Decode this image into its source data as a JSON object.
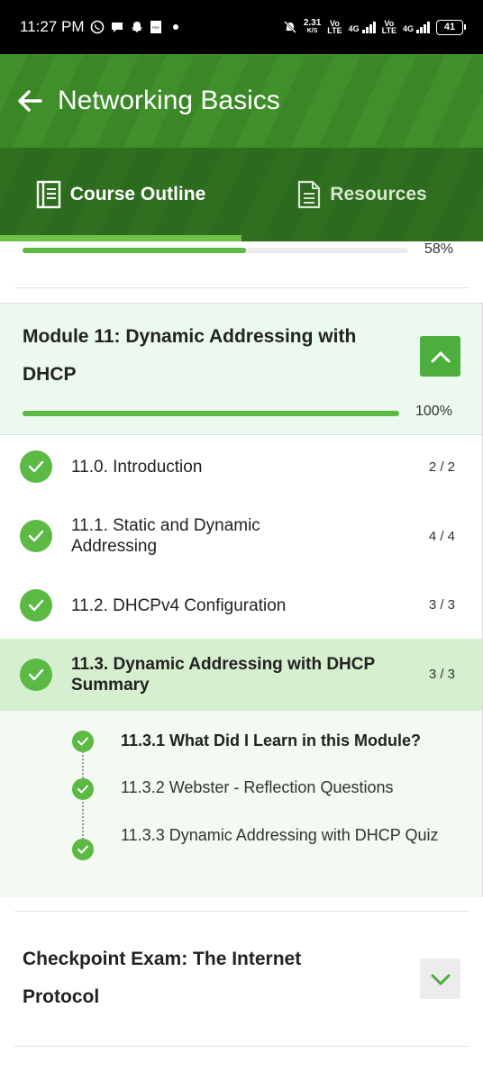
{
  "status_bar": {
    "time": "11:27 PM",
    "speed_value": "2.31",
    "speed_unit": "K/S",
    "sim1_tag_a": "Vo",
    "sim1_tag_b": "LTE",
    "sim1_net": "4G",
    "sim2_tag_a": "Vo",
    "sim2_tag_b": "LTE",
    "sim2_net": "4G",
    "battery": "41",
    "icons": [
      "whatsapp-icon",
      "chat-icon",
      "snapchat-icon",
      "pdf-icon",
      "dot-icon",
      "mute-bell-icon",
      "signal-icon",
      "battery-icon"
    ]
  },
  "header": {
    "title": "Networking Basics",
    "back_icon": "arrow-left-icon"
  },
  "tabs": [
    {
      "label": "Course Outline",
      "icon": "book-icon",
      "active": true
    },
    {
      "label": "Resources",
      "icon": "document-icon",
      "active": false
    }
  ],
  "overall_progress": {
    "percent_label": "58%",
    "value": 0.58
  },
  "module": {
    "title": "Module 11: Dynamic Addressing with DHCP",
    "percent_label": "100%",
    "value": 1.0,
    "collapse_icon": "chevron-up-icon",
    "lessons": [
      {
        "title": "11.0. Introduction",
        "count": "2 / 2"
      },
      {
        "title": "11.1. Static and Dynamic Addressing",
        "count": "4 / 4"
      },
      {
        "title": "11.2. DHCPv4 Configuration",
        "count": "3 / 3"
      },
      {
        "title": "11.3. Dynamic Addressing with DHCP Summary",
        "count": "3 / 3"
      }
    ],
    "sub_items": [
      {
        "title": "11.3.1 What Did I Learn in this Module?"
      },
      {
        "title": "11.3.2 Webster - Reflection Questions"
      },
      {
        "title": "11.3.3 Dynamic Addressing with DHCP Quiz"
      }
    ]
  },
  "next_module": {
    "title": "Checkpoint Exam: The Internet Protocol",
    "expand_icon": "chevron-down-icon"
  },
  "colors": {
    "header_green": "#3f8f2a",
    "tab_green": "#2f6f1f",
    "accent": "#5cb944",
    "module_bg": "#ecf9ee",
    "active_lesson_bg": "#d6efcf"
  }
}
